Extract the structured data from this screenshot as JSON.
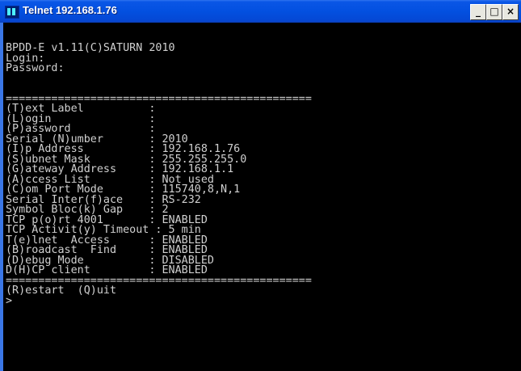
{
  "window": {
    "title": "Telnet 192.168.1.76",
    "minimize_label": "_",
    "maximize_label": "□",
    "close_label": "×"
  },
  "colors": {
    "titlebar": "#0350e0",
    "console_background": "#000000",
    "console_text": "#d0d0d0"
  },
  "terminal": {
    "lines": [
      "BPDD-E v1.11(C)SATURN 2010",
      "Login:",
      "Password:",
      "",
      "",
      "===============================================",
      "(T)ext Label          :",
      "(L)ogin               :",
      "(P)assword            :",
      "Serial (N)umber       : 2010",
      "(I)p Address          : 192.168.1.76",
      "(S)ubnet Mask         : 255.255.255.0",
      "(G)ateway Address     : 192.168.1.1",
      "(A)ccess List         : Not used",
      "(C)om Port Mode       : 115740,8,N,1",
      "Serial Inter(f)ace    : RS-232",
      "Symbol Bloc(k) Gap    : 2",
      "TCP p(o)rt 4001       : ENABLED",
      "TCP Activit(y) Timeout : 5 min",
      "T(e)lnet  Access      : ENABLED",
      "(B)roadcast  Find     : ENABLED",
      "(D)ebug Mode          : DISABLED",
      "D(H)CP client         : ENABLED",
      "===============================================",
      "(R)estart  (Q)uit",
      ">"
    ]
  }
}
